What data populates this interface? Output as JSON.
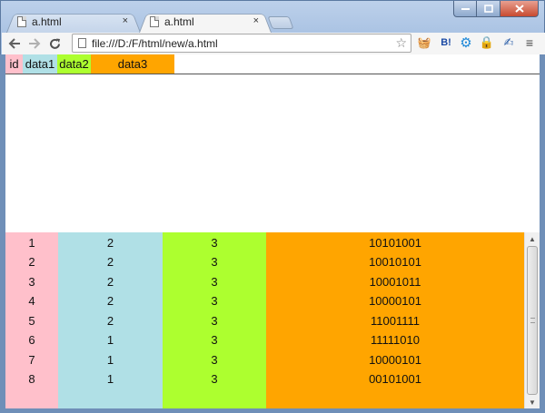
{
  "browser": {
    "tabs": [
      {
        "title": "a.html",
        "active": false
      },
      {
        "title": "a.html",
        "active": true
      }
    ],
    "close_glyph": "×",
    "url": "file:///D:/F/html/new/a.html",
    "toolbar_icons": [
      "back-arrow-icon",
      "forward-arrow-icon",
      "reload-icon",
      "page-icon",
      "bookmark-star-icon"
    ],
    "extensions": [
      {
        "name": "fruit-basket-extension-icon",
        "glyph": "🧺"
      },
      {
        "name": "hatena-bookmark-extension-icon",
        "glyph": "B!"
      },
      {
        "name": "gear-extension-icon",
        "glyph": "⚙"
      },
      {
        "name": "lock-extension-icon",
        "glyph": "🔒"
      },
      {
        "name": "signature-extension-icon",
        "glyph": "✍"
      },
      {
        "name": "menu-icon",
        "glyph": "≡"
      }
    ]
  },
  "colors": {
    "id": "#ffc0cb",
    "data1": "#b0e0e6",
    "data2": "#adff2f",
    "data3": "#ffa500"
  },
  "table": {
    "headers": [
      "id",
      "data1",
      "data2",
      "data3"
    ],
    "rows": [
      [
        "1",
        "2",
        "3",
        "10101001"
      ],
      [
        "2",
        "2",
        "3",
        "10010101"
      ],
      [
        "3",
        "2",
        "3",
        "10001011"
      ],
      [
        "4",
        "2",
        "3",
        "10000101"
      ],
      [
        "5",
        "2",
        "3",
        "11001111"
      ],
      [
        "6",
        "1",
        "3",
        "11111010"
      ],
      [
        "7",
        "1",
        "3",
        "10000101"
      ],
      [
        "8",
        "1",
        "3",
        "00101001"
      ]
    ]
  }
}
